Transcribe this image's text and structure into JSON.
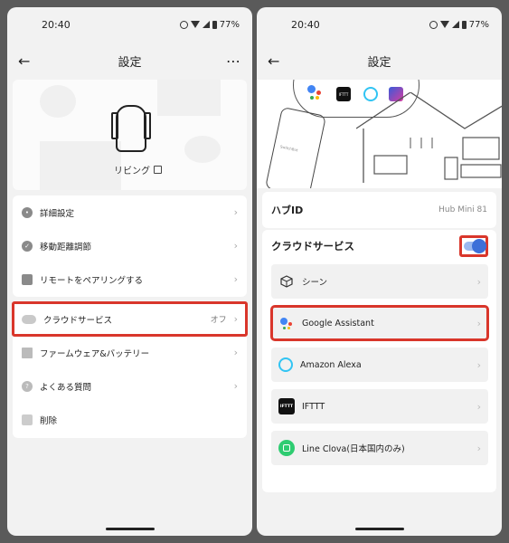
{
  "left": {
    "status": {
      "time": "20:40",
      "battery": "77%"
    },
    "nav": {
      "title": "設定"
    },
    "device": {
      "name": "リビング"
    },
    "menu": [
      {
        "label": "詳細設定",
        "value": ""
      },
      {
        "label": "移動距離調節",
        "value": ""
      },
      {
        "label": "リモートをペアリングする",
        "value": ""
      },
      {
        "label": "クラウドサービス",
        "value": "オフ"
      },
      {
        "label": "ファームウェア&バッテリー",
        "value": ""
      },
      {
        "label": "よくある質問",
        "value": ""
      },
      {
        "label": "削除",
        "value": ""
      }
    ]
  },
  "right": {
    "status": {
      "time": "20:40",
      "battery": "77%"
    },
    "nav": {
      "title": "設定"
    },
    "illustration": {
      "ifttt_badge": "IFTTT",
      "phone_text": "SwitchBot"
    },
    "hub": {
      "label": "ハブID",
      "value": "Hub Mini 81"
    },
    "cloud": {
      "title": "クラウドサービス",
      "enabled": true,
      "services": [
        {
          "label": "シーン",
          "icon": "scene-icon"
        },
        {
          "label": "Google Assistant",
          "icon": "google-assistant-icon"
        },
        {
          "label": "Amazon Alexa",
          "icon": "alexa-icon"
        },
        {
          "label": "IFTTT",
          "icon": "ifttt-icon"
        },
        {
          "label": "Line Clova(日本国内のみ)",
          "icon": "clova-icon"
        }
      ]
    }
  },
  "colors": {
    "highlight": "#d9362b",
    "toggle": "#3d6fd8"
  }
}
